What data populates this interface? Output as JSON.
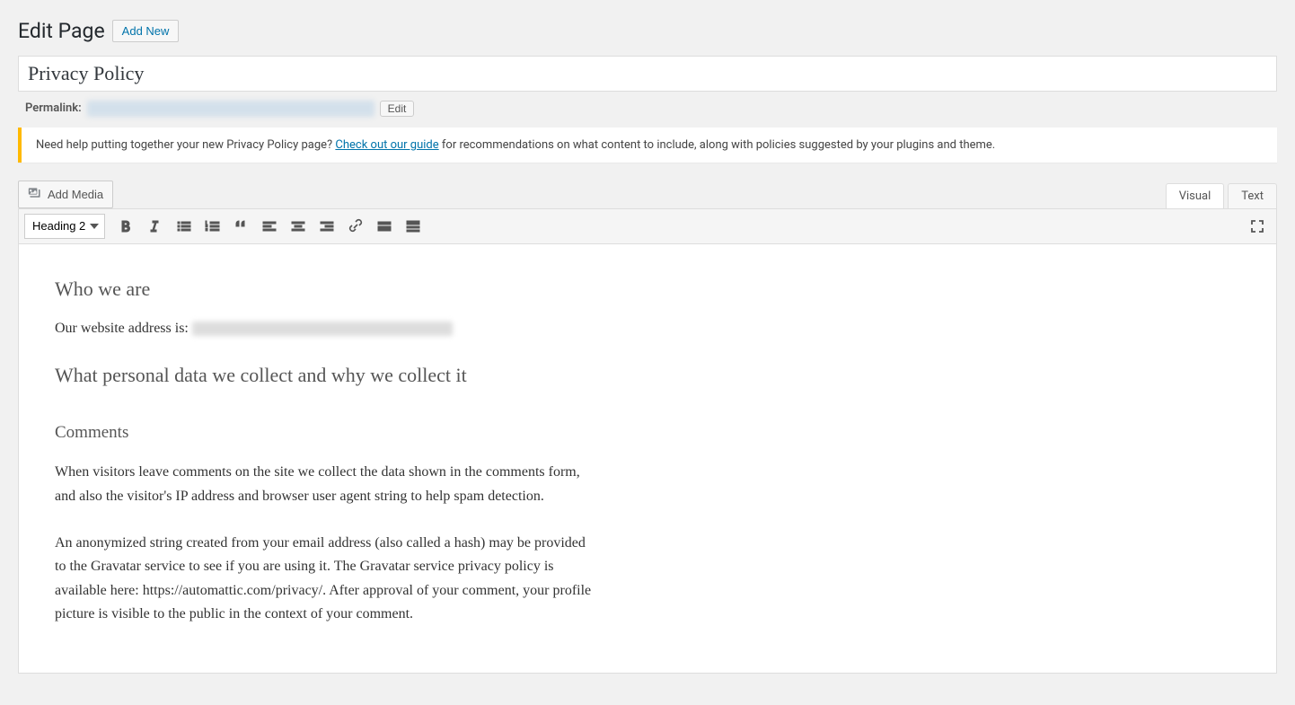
{
  "header": {
    "title": "Edit Page",
    "add_new": "Add New"
  },
  "post": {
    "title": "Privacy Policy"
  },
  "permalink": {
    "label": "Permalink:",
    "edit_btn": "Edit"
  },
  "notice": {
    "before": "Need help putting together your new Privacy Policy page? ",
    "link": "Check out our guide",
    "after": " for recommendations on what content to include, along with policies suggested by your plugins and theme."
  },
  "media": {
    "add_media": "Add Media"
  },
  "tabs": {
    "visual": "Visual",
    "text": "Text"
  },
  "toolbar": {
    "format": "Heading 2"
  },
  "content": {
    "h2_who": "Who we are",
    "p_address_prefix": "Our website address is: ",
    "h2_what": "What personal data we collect and why we collect it",
    "h3_comments": "Comments",
    "p_comments_1": "When visitors leave comments on the site we collect the data shown in the comments form, and also the visitor's IP address and browser user agent string to help spam detection.",
    "p_comments_2": "An anonymized string created from your email address (also called a hash) may be provided to the Gravatar service to see if you are using it. The Gravatar service privacy policy is available here: https://automattic.com/privacy/. After approval of your comment, your profile picture is visible to the public in the context of your comment."
  }
}
